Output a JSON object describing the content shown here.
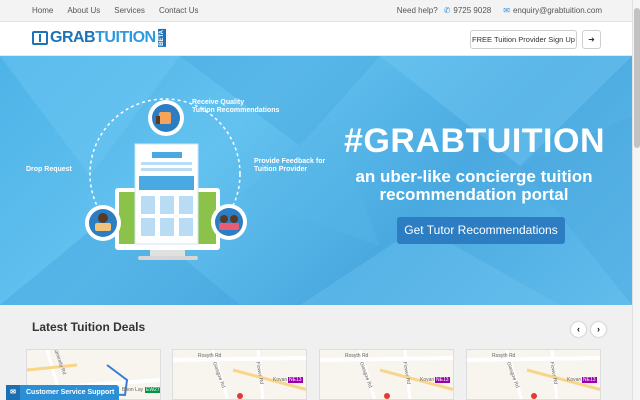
{
  "topbar": {
    "nav": [
      "Home",
      "About Us",
      "Services",
      "Contact Us"
    ],
    "need_help": "Need help?",
    "phone": "9725 9028",
    "email": "enquiry@grabtuition.com"
  },
  "header": {
    "logo_grab": "GRAB",
    "logo_tuition": "TUITION",
    "logo_beta": "BETA",
    "signup_label": "FREE Tuition Provider Sign Up",
    "login_icon": "sign-in-icon"
  },
  "hero": {
    "title": "#GRABTUITION",
    "subtitle_line1": "an uber-like concierge tuition",
    "subtitle_line2": "recommendation portal",
    "cta_label": "Get Tutor Recommendations",
    "steps": {
      "receive": [
        "Receive Quality",
        "Tuition Recommendations"
      ],
      "drop": "Drop Request",
      "feedback": [
        "Provide Feedback for",
        "Tuition Provider"
      ]
    },
    "colors": {
      "accent": "#2c7dc2",
      "bg": "#5ab9ec"
    }
  },
  "deals": {
    "title": "Latest Tuition Deals",
    "prev_icon": "chevron-left-icon",
    "next_icon": "chevron-right-icon",
    "cards": [
      {
        "roads": [
          "Admiralty Rd",
          "Boon Lay"
        ],
        "station": "EW27"
      },
      {
        "roads": [
          "Rosyth Rd",
          "Glasgow Rd",
          "Flower Rd",
          "Kovan"
        ],
        "station": "NE13"
      },
      {
        "roads": [
          "Rosyth Rd",
          "Glasgow Rd",
          "Flower Rd",
          "Kovan"
        ],
        "station": "NE13"
      },
      {
        "roads": [
          "Rosyth Rd",
          "Glasgow Rd",
          "Flower Rd",
          "Kovan"
        ],
        "station": "NE13"
      }
    ]
  },
  "support": {
    "label": "Customer Service Support"
  }
}
